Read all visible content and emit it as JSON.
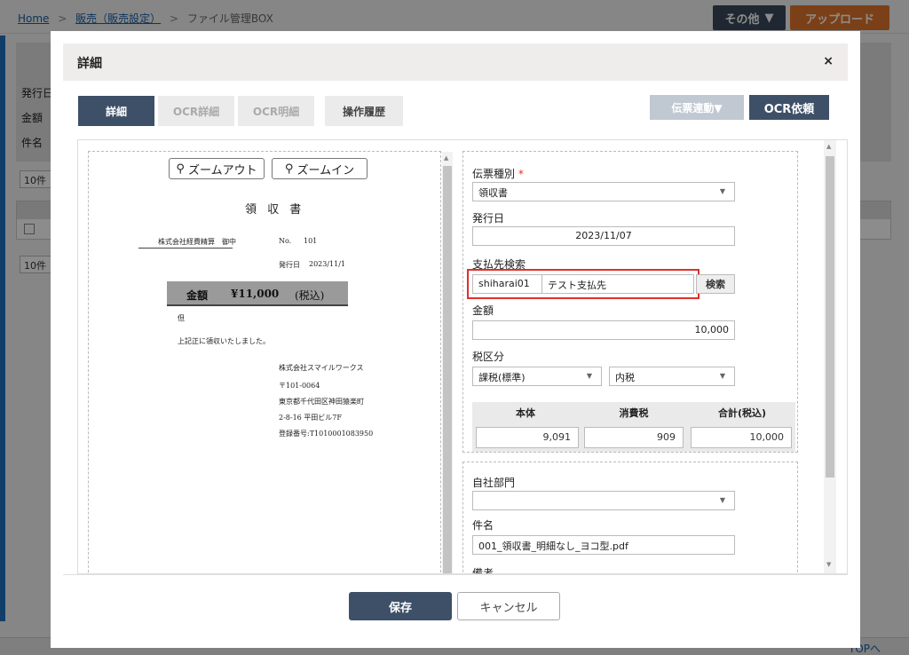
{
  "breadcrumb": {
    "home": "Home",
    "sales": "販売（販売設定）",
    "current": "ファイル管理BOX",
    "separator": ">"
  },
  "header": {
    "other_label": "その他",
    "upload_label": "アップロード"
  },
  "background": {
    "labels": [
      "発行日",
      "金額",
      "件名"
    ],
    "per_page": "10件",
    "top_link": "TOPへ"
  },
  "modal": {
    "title": "詳細",
    "close": "×",
    "tabs": [
      {
        "label": "詳細",
        "state": "active"
      },
      {
        "label": "OCR詳細",
        "state": "disabled"
      },
      {
        "label": "OCR明細",
        "state": "disabled"
      },
      {
        "label": "操作履歴",
        "state": "enabled"
      }
    ],
    "link_button": "伝票連動▼",
    "ocr_button": "OCR依頼",
    "save_button": "保存",
    "cancel_button": "キャンセル"
  },
  "preview": {
    "zoom_out": "ズームアウト",
    "zoom_in": "ズームイン",
    "doc_title": "領 収 書",
    "addressee": "株式会社経費精算",
    "honorific": "御中",
    "no_label": "No.",
    "no_value": "101",
    "date_label": "発行日",
    "date_value": "2023/11/1",
    "amount_label": "金額",
    "amount_value": "¥11,000",
    "tax_note": "(税込)",
    "tadashi": "但",
    "received": "上記正に領収いたしました。",
    "issuer_lines": [
      "株式会社スマイルワークス",
      "〒101-0064",
      "東京都千代田区神田猿楽町",
      "2-8-16 平田ビル7F",
      "登録番号:T1010001083950"
    ]
  },
  "form": {
    "slip_type_label": "伝票種別",
    "required_mark": "*",
    "slip_type_value": "領収書",
    "issue_date_label": "発行日",
    "issue_date_value": "2023/11/07",
    "payee_label": "支払先検索",
    "payee_code": "shiharai01",
    "payee_name": "テスト支払先",
    "search_button": "検索",
    "amount_label": "金額",
    "amount_value": "10,000",
    "tax_label": "税区分",
    "tax_type": "課税(標準)",
    "tax_inclusion": "内税",
    "tax_table": {
      "headers": [
        "本体",
        "消費税",
        "合計(税込)"
      ],
      "values": [
        "9,091",
        "909",
        "10,000"
      ]
    },
    "dept_label": "自社部門",
    "dept_value": "",
    "subject_label": "件名",
    "subject_value": "001_領収書_明細なし_ヨコ型.pdf",
    "memo_label": "備考"
  },
  "icons": {
    "search": "search-icon",
    "dropdown": "chevron-down-icon",
    "close": "close-icon"
  },
  "colors": {
    "primary": "#3e5068",
    "accent": "#e0762a",
    "highlight": "#e0302a"
  }
}
